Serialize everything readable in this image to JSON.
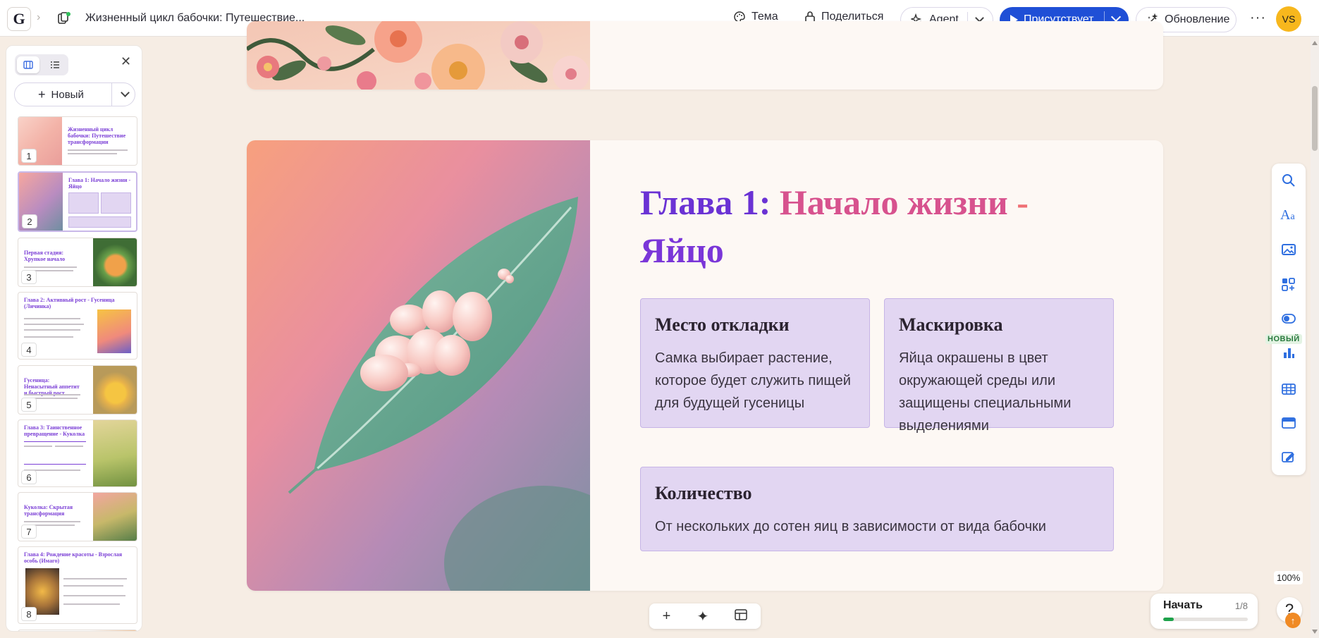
{
  "header": {
    "logo": "G",
    "doc_title": "Жизненный цикл бабочки: Путешествие...",
    "theme_label": "Тема",
    "share_label": "Поделиться",
    "agent_label": "Agent",
    "present_label": "Присутствует",
    "update_label": "Обновление",
    "avatar_initials": "VS"
  },
  "sidebar": {
    "new_label": "Новый",
    "thumbnails": [
      {
        "num": "1",
        "title": "Жизненный цикл бабочки: Путешествие трансформации"
      },
      {
        "num": "2",
        "title": "Глава 1: Начало жизни - Яйцо"
      },
      {
        "num": "3",
        "title": "Первая стадия: Хрупкое начало"
      },
      {
        "num": "4",
        "title": "Глава 2: Активный рост - Гусеница (Личинка)"
      },
      {
        "num": "5",
        "title": "Гусеница: Ненасытный аппетит и быстрый рост"
      },
      {
        "num": "6",
        "title": "Глава 3: Таинственное превращение - Куколка"
      },
      {
        "num": "7",
        "title": "Куколка: Скрытая трансформация"
      },
      {
        "num": "8",
        "title": "Глава 4: Рождение красоты - Взрослая особь (Имаго)"
      }
    ]
  },
  "slide": {
    "heading_part1": "Глава 1:",
    "heading_part2": "Начало жизни",
    "heading_part3": "-",
    "heading_part4": "Яйцо",
    "cards": [
      {
        "title": "Место откладки",
        "body": "Самка выбирает растение, которое будет служить пищей для будущей гусеницы"
      },
      {
        "title": "Маскировка",
        "body": "Яйца окрашены в цвет окружающей среды или защищены специальными выделениями"
      },
      {
        "title": "Количество",
        "body": "От нескольких до сотен яиц в зависимости от вида бабочки"
      }
    ]
  },
  "rail": {
    "new_badge": "НОВЫЙ",
    "icons": [
      "search-icon",
      "text-style-icon",
      "image-icon",
      "add-block-icon",
      "toggle-icon",
      "chart-icon",
      "film-icon",
      "card-layout-icon",
      "edit-icon"
    ]
  },
  "zoom_level": "100%",
  "start": {
    "label": "Начать",
    "count": "1/8",
    "progress": 0.125
  },
  "help_label": "?",
  "colors": {
    "accent_blue": "#1f4fd6",
    "heading_purple": "#6a32d4",
    "heading_pink": "#d7528e",
    "card_bg": "#e2d6f2",
    "progress_green": "#1ea24b"
  }
}
